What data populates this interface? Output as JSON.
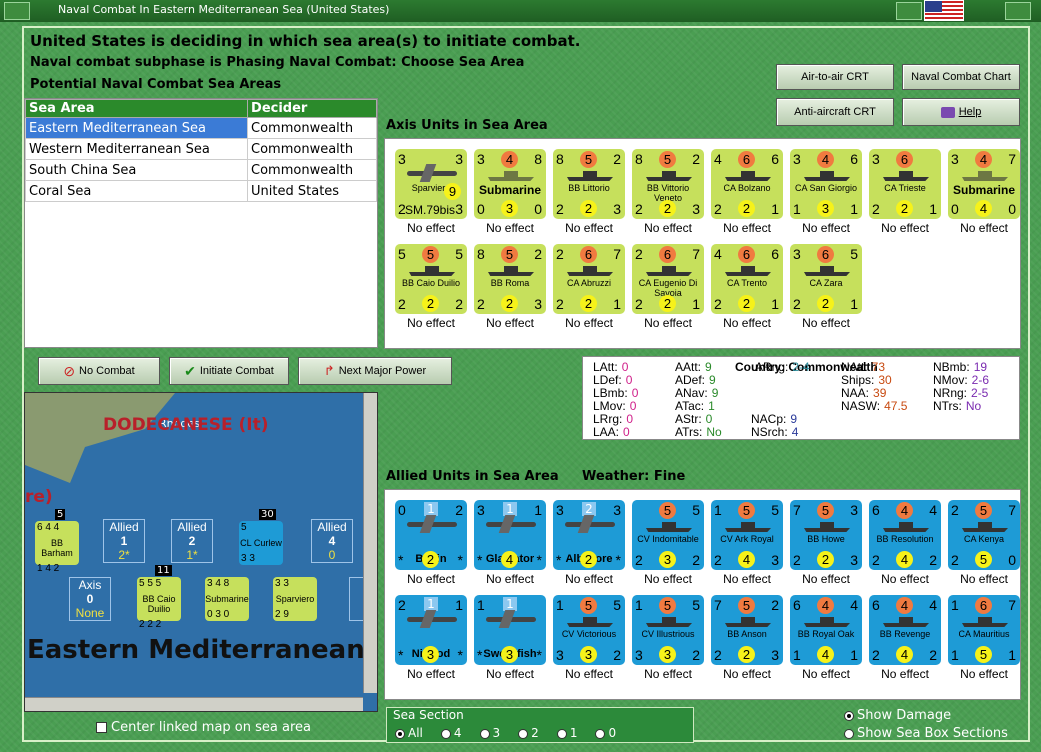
{
  "window": {
    "title": "Naval Combat In Eastern Mediterranean Sea (United States)"
  },
  "headline": "United States is deciding in which sea area(s) to initiate combat.",
  "subphase": "Naval combat subphase is Phasing Naval Combat: Choose Sea Area",
  "potential_label": "Potential Naval Combat Sea Areas",
  "buttons": {
    "air_crt": "Air-to-air CRT",
    "naval_chart": "Naval Combat Chart",
    "aa_crt": "Anti-aircraft CRT",
    "help": "Help",
    "no_combat": "No Combat",
    "initiate": "Initiate Combat",
    "next_major": "Next Major Power"
  },
  "sea_table": {
    "headers": [
      "Sea Area",
      "Decider"
    ],
    "rows": [
      {
        "area": "Eastern Mediterranean Sea",
        "decider": "Commonwealth"
      },
      {
        "area": "Western Mediterranean Sea",
        "decider": "Commonwealth"
      },
      {
        "area": "South China Sea",
        "decider": "Commonwealth"
      },
      {
        "area": "Coral Sea",
        "decider": "United States"
      }
    ]
  },
  "axis_label": "Axis Units in Sea Area",
  "allied_label": "Allied Units in Sea Area",
  "weather_label": "Weather:",
  "weather": "Fine",
  "axis_units": [
    {
      "name": "Sparviero",
      "kind": "plane",
      "tl": "3",
      "tr": "3",
      "bl": "2",
      "mid": "9",
      "bm": "SM.79bis",
      "br": "3",
      "effect": "No effect"
    },
    {
      "name": "Submarine",
      "kind": "sub",
      "tl": "3",
      "tm": "4",
      "tr": "8",
      "bl": "0",
      "bm": "3",
      "br": "0",
      "effect": "No effect"
    },
    {
      "name": "BB Littorio",
      "kind": "ship",
      "tl": "8",
      "tm": "5",
      "tr": "2",
      "bl": "2",
      "bm": "2",
      "br": "3",
      "effect": "No effect"
    },
    {
      "name": "BB Vittorio Veneto",
      "kind": "ship",
      "tl": "8",
      "tm": "5",
      "tr": "2",
      "bl": "2",
      "bm": "2",
      "br": "3",
      "effect": "No effect"
    },
    {
      "name": "CA Bolzano",
      "kind": "ship",
      "tl": "4",
      "tm": "6",
      "tr": "6",
      "bl": "2",
      "bm": "2",
      "br": "1",
      "effect": "No effect"
    },
    {
      "name": "CA San Giorgio",
      "kind": "ship",
      "tl": "3",
      "tm": "4",
      "tr": "6",
      "bl": "1",
      "bm": "3",
      "br": "1",
      "effect": "No effect"
    },
    {
      "name": "CA Trieste",
      "kind": "ship",
      "tl": "3",
      "tm": "6",
      "tr": "",
      "bl": "2",
      "bm": "2",
      "br": "1",
      "effect": "No effect"
    },
    {
      "name": "Submarine",
      "kind": "sub",
      "tl": "3",
      "tm": "4",
      "tr": "7",
      "bl": "0",
      "bm": "4",
      "br": "0",
      "effect": "No effect"
    },
    {
      "name": "BB Caio Duilio",
      "kind": "ship",
      "tl": "5",
      "tm": "5",
      "tr": "5",
      "bl": "2",
      "bm": "2",
      "br": "2",
      "effect": "No effect"
    },
    {
      "name": "BB Roma",
      "kind": "ship",
      "tl": "8",
      "tm": "5",
      "tr": "2",
      "bl": "2",
      "bm": "2",
      "br": "3",
      "effect": "No effect"
    },
    {
      "name": "CA Abruzzi",
      "kind": "ship",
      "tl": "2",
      "tm": "6",
      "tr": "7",
      "bl": "2",
      "bm": "2",
      "br": "1",
      "effect": "No effect"
    },
    {
      "name": "CA Eugenio Di Savoia",
      "kind": "ship",
      "tl": "2",
      "tm": "6",
      "tr": "7",
      "bl": "2",
      "bm": "2",
      "br": "1",
      "effect": "No effect"
    },
    {
      "name": "CA Trento",
      "kind": "ship",
      "tl": "4",
      "tm": "6",
      "tr": "6",
      "bl": "2",
      "bm": "2",
      "br": "1",
      "effect": "No effect"
    },
    {
      "name": "CA Zara",
      "kind": "ship",
      "tl": "3",
      "tm": "6",
      "tr": "5",
      "bl": "2",
      "bm": "2",
      "br": "1",
      "effect": "No effect"
    }
  ],
  "allied_units": [
    {
      "name": "Baffin",
      "kind": "plane",
      "tl": "0",
      "tm": "1",
      "tr": "2",
      "bl": "*",
      "bm": "2",
      "br": "*",
      "effect": "No effect"
    },
    {
      "name": "Gladiator",
      "kind": "plane",
      "tl": "3",
      "tm": "1",
      "tr": "1",
      "bl": "*",
      "bm": "4",
      "br": "*",
      "effect": "No effect"
    },
    {
      "name": "Albacore",
      "kind": "plane",
      "tl": "3",
      "tm": "2",
      "tr": "3",
      "bl": "*",
      "bm": "2",
      "br": "*",
      "effect": "No effect"
    },
    {
      "name": "CV Indomitable",
      "kind": "ship",
      "tl": "",
      "tm": "5",
      "tr": "5",
      "bl": "2",
      "bm": "3",
      "br": "2",
      "effect": "No effect"
    },
    {
      "name": "CV Ark Royal",
      "kind": "ship",
      "tl": "1",
      "tm": "5",
      "tr": "5",
      "bl": "2",
      "bm": "4",
      "br": "3",
      "effect": "No effect"
    },
    {
      "name": "BB Howe",
      "kind": "ship",
      "tl": "7",
      "tm": "5",
      "tr": "3",
      "bl": "2",
      "bm": "2",
      "br": "3",
      "effect": "No effect"
    },
    {
      "name": "BB Resolution",
      "kind": "ship",
      "tl": "6",
      "tm": "4",
      "tr": "4",
      "bl": "2",
      "bm": "4",
      "br": "2",
      "effect": "No effect"
    },
    {
      "name": "CA Kenya",
      "kind": "ship",
      "tl": "2",
      "tm": "5",
      "tr": "7",
      "bl": "2",
      "bm": "5",
      "br": "0",
      "effect": "No effect"
    },
    {
      "name": "Nimrod",
      "kind": "plane",
      "tl": "2",
      "tm": "1",
      "tr": "1",
      "bl": "*",
      "bm": "3",
      "br": "*",
      "effect": "No effect"
    },
    {
      "name": "Swordfish",
      "kind": "plane",
      "tl": "1",
      "tm": "1",
      "tr": "",
      "bl": "*",
      "bm": "3",
      "br": "*",
      "effect": "No effect"
    },
    {
      "name": "CV Victorious",
      "kind": "ship",
      "tl": "1",
      "tm": "5",
      "tr": "5",
      "bl": "3",
      "bm": "3",
      "br": "2",
      "effect": "No effect"
    },
    {
      "name": "CV Illustrious",
      "kind": "ship",
      "tl": "1",
      "tm": "5",
      "tr": "5",
      "bl": "3",
      "bm": "3",
      "br": "2",
      "effect": "No effect"
    },
    {
      "name": "BB Anson",
      "kind": "ship",
      "tl": "7",
      "tm": "5",
      "tr": "2",
      "bl": "2",
      "bm": "2",
      "br": "3",
      "effect": "No effect"
    },
    {
      "name": "BB Royal Oak",
      "kind": "ship",
      "tl": "6",
      "tm": "4",
      "tr": "4",
      "bl": "1",
      "bm": "4",
      "br": "1",
      "effect": "No effect"
    },
    {
      "name": "BB Revenge",
      "kind": "ship",
      "tl": "6",
      "tm": "4",
      "tr": "4",
      "bl": "2",
      "bm": "4",
      "br": "2",
      "effect": "No effect"
    },
    {
      "name": "CA Mauritius",
      "kind": "ship",
      "tl": "1",
      "tm": "6",
      "tr": "7",
      "bl": "1",
      "bm": "5",
      "br": "1",
      "effect": "No effect"
    }
  ],
  "stats": {
    "col1": [
      {
        "k": "LAtt:",
        "v": "0"
      },
      {
        "k": "LDef:",
        "v": "0"
      },
      {
        "k": "LBmb:",
        "v": "0"
      },
      {
        "k": "LMov:",
        "v": "0"
      },
      {
        "k": "LRrg:",
        "v": "0"
      },
      {
        "k": "LAA:",
        "v": "0"
      }
    ],
    "col2": [
      {
        "k": "AAtt:",
        "v": "9"
      },
      {
        "k": "ADef:",
        "v": "9"
      },
      {
        "k": "ANav:",
        "v": "9"
      },
      {
        "k": "ATac:",
        "v": "1"
      },
      {
        "k": "AStr:",
        "v": "0"
      },
      {
        "k": "ATrs:",
        "v": "No"
      }
    ],
    "country_label": "Country:",
    "country": "Commonwealth",
    "col3": [
      {
        "k": "ARng:",
        "v": "2-4"
      },
      {
        "k": "NACp:",
        "v": "9"
      },
      {
        "k": "NSrch:",
        "v": "4"
      }
    ],
    "col4": [
      {
        "k": "NAtt:",
        "v": "73"
      },
      {
        "k": "Ships:",
        "v": "30"
      },
      {
        "k": "NAA:",
        "v": "39"
      },
      {
        "k": "NASW:",
        "v": "47.5"
      }
    ],
    "col5": [
      {
        "k": "NBmb:",
        "v": "19"
      },
      {
        "k": "NMov:",
        "v": "2-6"
      },
      {
        "k": "NRng:",
        "v": "2-5"
      },
      {
        "k": "NTrs:",
        "v": "No"
      }
    ]
  },
  "map": {
    "title": "DODECANESE (It)",
    "rhodes": "Rhodes",
    "sea_name": "Eastern Mediterranean",
    "partial": "re)",
    "boxes": [
      {
        "label": "Allied",
        "num": "1",
        "sub": "2*"
      },
      {
        "label": "Allied",
        "num": "2",
        "sub": "1*"
      },
      {
        "label": "Allied",
        "num": "4",
        "sub": "0"
      },
      {
        "label": "Axis",
        "num": "0",
        "sub": "None"
      },
      {
        "label": "A",
        "num": "",
        "sub": ""
      }
    ],
    "stack_counts": [
      "5",
      "30",
      "11",
      "3"
    ],
    "counters": [
      {
        "name": "BB Barham",
        "t": "6 4 4",
        "b": "1 4 2"
      },
      {
        "name": "CL Curlew",
        "t": "5",
        "b": "3 3"
      },
      {
        "name": "BB Caio Duilio",
        "t": "5 5 5",
        "b": "2 2 2"
      },
      {
        "name": "Submarine",
        "t": "3 4 8",
        "b": "0 3 0"
      },
      {
        "name": "Sparviero",
        "t": "3 3",
        "b": "2 9"
      }
    ]
  },
  "center_map": "Center linked map on sea area",
  "sea_section": {
    "label": "Sea Section",
    "options": [
      "All",
      "4",
      "3",
      "2",
      "1",
      "0"
    ],
    "selected": "All"
  },
  "show_damage": "Show Damage",
  "show_sections": "Show Sea Box Sections"
}
